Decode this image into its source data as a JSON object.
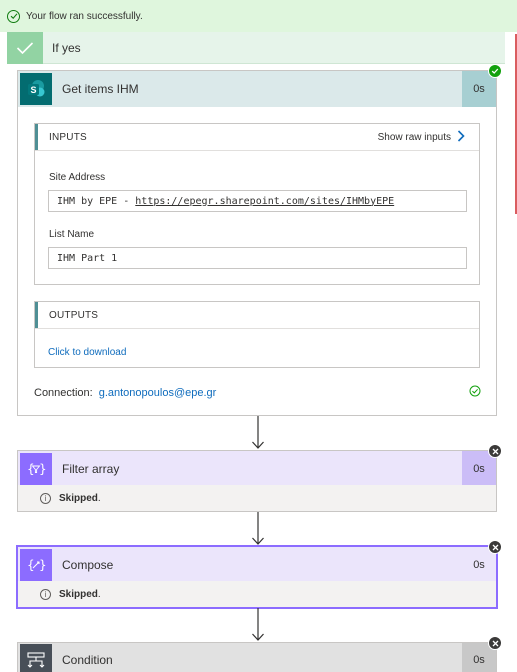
{
  "banner": {
    "message": "Your flow ran successfully."
  },
  "branch": {
    "label": "If yes"
  },
  "get_items": {
    "title": "Get items IHM",
    "duration": "0s",
    "inputs": {
      "header": "INPUTS",
      "raw_label": "Show raw inputs",
      "site_address_label": "Site Address",
      "site_address_prefix": "IHM by EPE - ",
      "site_address_url": "https://epegr.sharepoint.com/sites/IHMbyEPE",
      "list_name_label": "List Name",
      "list_name_value": "IHM Part 1"
    },
    "outputs": {
      "header": "OUTPUTS",
      "download_label": "Click to download"
    },
    "connection": {
      "label": "Connection:",
      "account": "g.antonopoulos@epe.gr"
    }
  },
  "filter_array": {
    "title": "Filter array",
    "duration": "0s",
    "status": "Skipped",
    "status_suffix": "."
  },
  "compose": {
    "title": "Compose",
    "duration": "0s",
    "status": "Skipped",
    "status_suffix": "."
  },
  "condition": {
    "title": "Condition",
    "duration": "0s"
  },
  "icons": {
    "success": "check-circle-icon",
    "sharepoint": "sharepoint-icon",
    "filter": "filter-array-icon",
    "compose": "compose-icon",
    "condition": "condition-icon",
    "skipped": "close-circle-icon"
  },
  "colors": {
    "sharepoint": "#036c70",
    "data_operation": "#8c6cff",
    "condition": "#484f58",
    "success": "#13a10e",
    "link": "#0f6cbd"
  }
}
